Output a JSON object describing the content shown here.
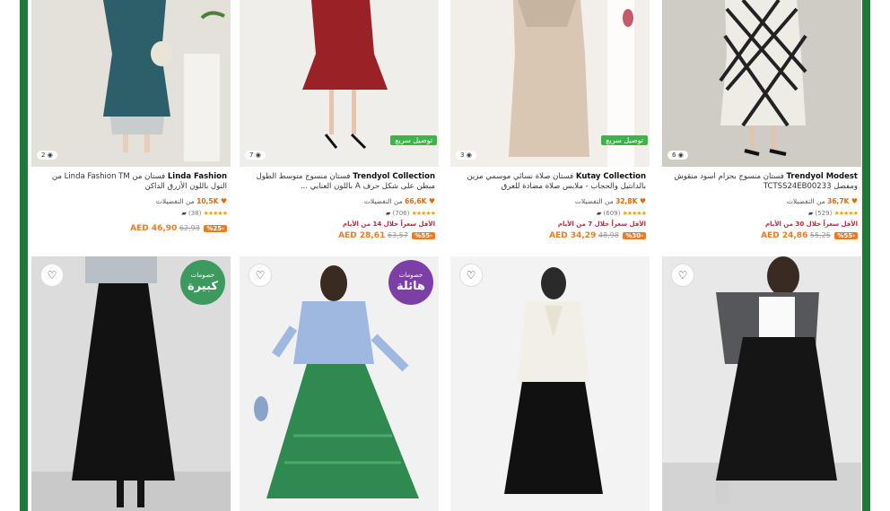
{
  "colors": {
    "frame": "#1f7a3a",
    "accent": "#f27a1a",
    "fav": "#e06a00",
    "lowest": "#d21f3c",
    "fast": "#3bb44a"
  },
  "products_top": [
    {
      "brand": "Linda Fashion",
      "title": "فستان من Linda Fashion TM من التول باللون الأزرق الداكن",
      "fav_count": "10,5K",
      "fav_text": "من التفضيلات",
      "reviews": "(38)",
      "lowest_text": "",
      "price": "AED 46,90",
      "old_price": "62,93",
      "discount": "-%25",
      "images": "2",
      "fast": ""
    },
    {
      "brand": "Trendyol Collection",
      "title": "فستان منسوج متوسط الطول مبطن على شكل حرف A باللون العنابي ...",
      "fav_count": "66,6K",
      "fav_text": "من التفضيلات",
      "reviews": "(706)",
      "lowest_text": "الأقل سعراً خلال 14 من الأيام",
      "price": "AED 28,61",
      "old_price": "63,57",
      "discount": "-%55",
      "images": "7",
      "fast": "توصيل سريع"
    },
    {
      "brand": "Kutay Collection",
      "title": "فستان صلاة نسائي موسمي مزين بالدانتيل والحجاب - ملابس صلاة مضادة للعرق",
      "fav_count": "32,8K",
      "fav_text": "من التفضيلات",
      "reviews": "(609)",
      "lowest_text": "الأقل سعراً خلال 7 من الأيام",
      "price": "AED 34,29",
      "old_price": "48,98",
      "discount": "-%30",
      "images": "3",
      "fast": "توصيل سريع"
    },
    {
      "brand": "Trendyol Modest",
      "title": "فستان منسوج بحزام أسود منقوش ومفصل TCTSS24EB00233",
      "fav_count": "36,7K",
      "fav_text": "من التفضيلات",
      "reviews": "(529)",
      "lowest_text": "الأقل سعراً خلال 30 من الأيام",
      "price": "AED 24,86",
      "old_price": "55,25",
      "discount": "-%55",
      "images": "6",
      "fast": ""
    }
  ],
  "promo": {
    "green_small": "خصومات",
    "green_big": "كبيرة",
    "purple_small": "خصومات",
    "purple_big": "هائلة"
  },
  "icons": {
    "favorite": "heart-outline-icon",
    "camera": "camera-icon",
    "star": "star-icon"
  }
}
